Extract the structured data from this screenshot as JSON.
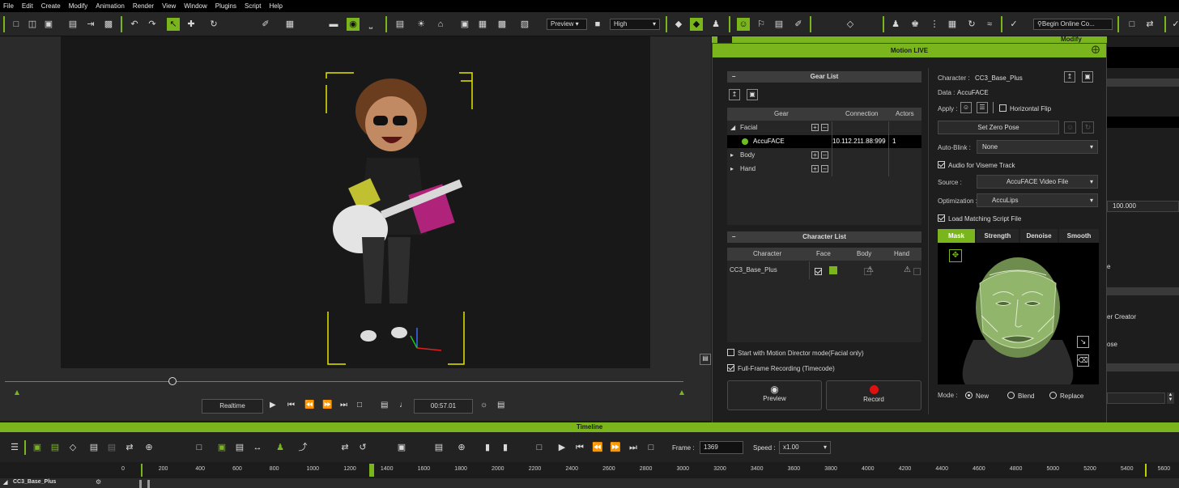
{
  "menu": [
    "File",
    "Edit",
    "Create",
    "Modify",
    "Animation",
    "Render",
    "View",
    "Window",
    "Plugins",
    "Script",
    "Help"
  ],
  "toolbar": {
    "preview_mode": "Preview",
    "quality": "High",
    "search_placeholder": "Begin Online Co..."
  },
  "modify_title": "Modify",
  "right_strip": {
    "value": "100.000",
    "text1": "e",
    "text2": "er Creator",
    "text3": "ose"
  },
  "viewport": {
    "playback_mode": "Realtime",
    "time": "00:57.01"
  },
  "panel": {
    "title": "Motion LIVE",
    "collapse": "–",
    "gear_list": {
      "title": "Gear List",
      "columns": [
        "Gear",
        "Connection",
        "Actors"
      ],
      "rows": [
        {
          "name": "Facial",
          "connection": "",
          "actors": ""
        },
        {
          "name": "AccuFACE",
          "connection": "10.112.211.88:999",
          "actors": "1"
        },
        {
          "name": "Body",
          "connection": "",
          "actors": ""
        },
        {
          "name": "Hand",
          "connection": "",
          "actors": ""
        }
      ]
    },
    "character_list": {
      "title": "Character List",
      "columns": [
        "Character",
        "Face",
        "Body",
        "Hand"
      ],
      "rows": [
        {
          "name": "CC3_Base_Plus"
        }
      ]
    },
    "start_with_md": "Start with Motion Director mode(Facial only)",
    "full_frame": "Full-Frame Recording (Timecode)",
    "preview_btn": "Preview",
    "record_btn": "Record",
    "character_label": "Character :",
    "character_value": "CC3_Base_Plus",
    "data_label": "Data :",
    "data_value": "AccuFACE",
    "apply_label": "Apply :",
    "horizontal_flip": "Horizontal Flip",
    "set_zero_pose": "Set Zero Pose",
    "auto_blink_label": "Auto-Blink :",
    "auto_blink_value": "None",
    "audio_viseme": "Audio for Viseme Track",
    "source_label": "Source :",
    "source_value": "AccuFACE Video File",
    "optimization_label": "Optimization :",
    "optimization_value": "AccuLips",
    "load_script": "Load Matching Script File",
    "tabs": [
      "Mask",
      "Strength",
      "Denoise",
      "Smooth"
    ],
    "mode_label": "Mode :",
    "modes": [
      "New",
      "Blend",
      "Replace"
    ]
  },
  "timeline": {
    "title": "Timeline",
    "frame_label": "Frame :",
    "frame_value": "1369",
    "speed_label": "Speed :",
    "speed_value": "x1.00",
    "ruler": [
      "0",
      "200",
      "400",
      "600",
      "800",
      "1000",
      "1200",
      "1400",
      "1600",
      "1800",
      "2000",
      "2200",
      "2400",
      "2600",
      "2800",
      "3000",
      "3200",
      "3400",
      "3600",
      "3800",
      "4000",
      "4200",
      "4400",
      "4600",
      "4800",
      "5000",
      "5200",
      "5400",
      "5600"
    ],
    "track_name": "CC3_Base_Plus"
  },
  "colors": {
    "accent": "#7ab51d",
    "record": "#e01010",
    "connected": "#6bbf22"
  }
}
